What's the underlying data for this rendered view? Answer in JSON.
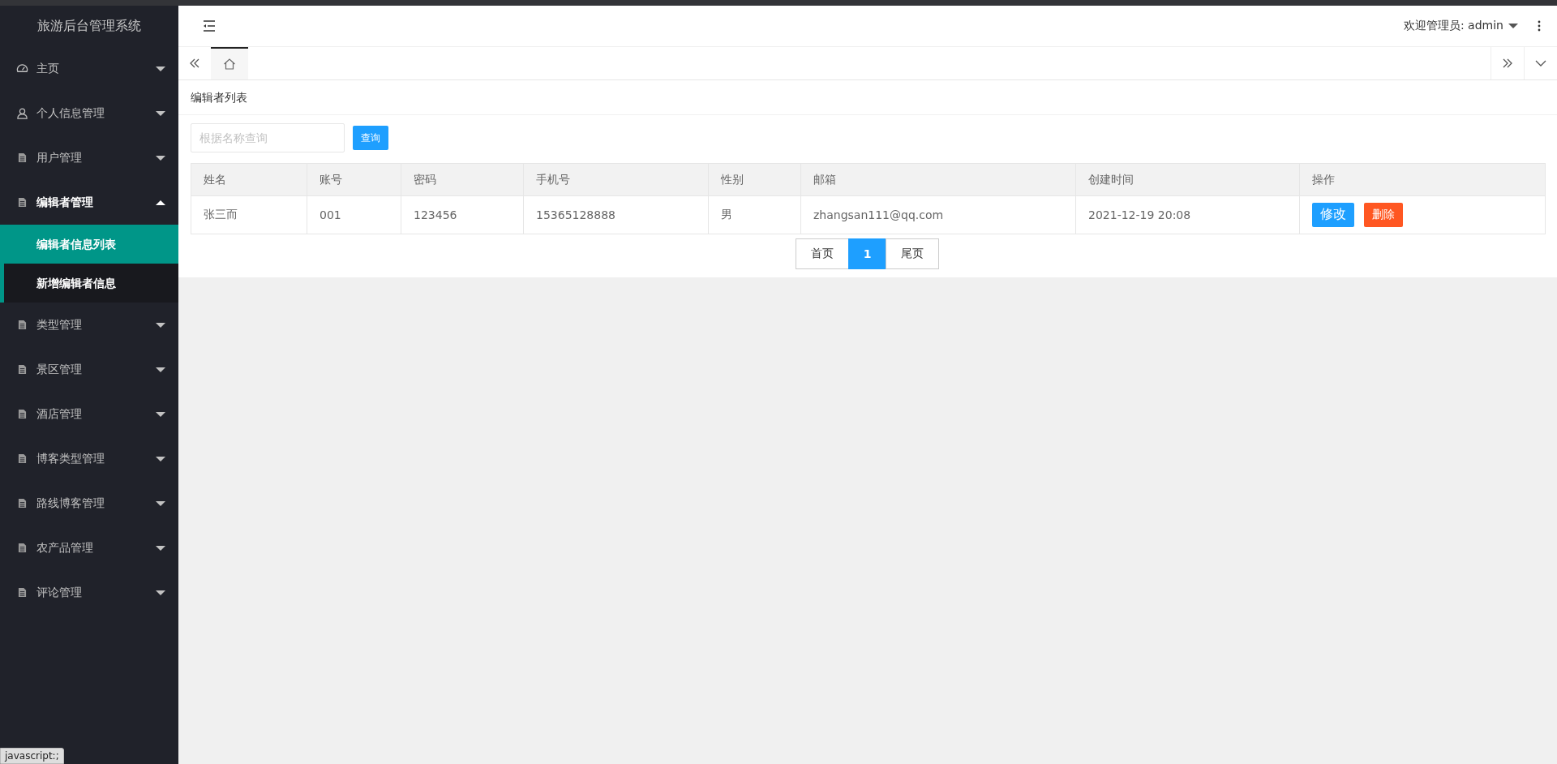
{
  "sidebar": {
    "title": "旅游后台管理系统",
    "items": [
      {
        "label": "主页",
        "kind": "gauge",
        "expanded": false
      },
      {
        "label": "个人信息管理",
        "kind": "user",
        "expanded": false
      },
      {
        "label": "用户管理",
        "kind": "doc",
        "expanded": false
      },
      {
        "label": "编辑者管理",
        "kind": "doc",
        "expanded": true,
        "children": [
          {
            "label": "编辑者信息列表",
            "selected": true
          },
          {
            "label": "新增编辑者信息",
            "selected": false
          }
        ]
      },
      {
        "label": "类型管理",
        "kind": "doc",
        "expanded": false
      },
      {
        "label": "景区管理",
        "kind": "doc",
        "expanded": false
      },
      {
        "label": "酒店管理",
        "kind": "doc",
        "expanded": false
      },
      {
        "label": "博客类型管理",
        "kind": "doc",
        "expanded": false
      },
      {
        "label": "路线博客管理",
        "kind": "doc",
        "expanded": false
      },
      {
        "label": "农产品管理",
        "kind": "doc",
        "expanded": false
      },
      {
        "label": "评论管理",
        "kind": "doc",
        "expanded": false
      }
    ]
  },
  "header": {
    "welcome": "欢迎管理员: admin"
  },
  "tabs": [
    {
      "kind": "home",
      "selected": true
    }
  ],
  "card": {
    "title": "编辑者列表",
    "search": {
      "placeholder": "根据名称查询",
      "button": "查询"
    },
    "table": {
      "columns": [
        "姓名",
        "账号",
        "密码",
        "手机号",
        "性别",
        "邮箱",
        "创建时间",
        "操作"
      ],
      "rows": [
        {
          "cells": [
            "张三而",
            "001",
            "123456",
            "15365128888",
            "男",
            "zhangsan111@qq.com",
            "2021-12-19 20:08"
          ],
          "actions": [
            {
              "label": "修改",
              "kind": "edit"
            },
            {
              "label": "删除",
              "kind": "delete"
            }
          ]
        }
      ]
    },
    "pagination": [
      {
        "label": "首页",
        "selected": false
      },
      {
        "label": "1",
        "selected": true
      },
      {
        "label": "尾页",
        "selected": false
      }
    ]
  },
  "status_bar": {
    "text": "javascript:;"
  }
}
